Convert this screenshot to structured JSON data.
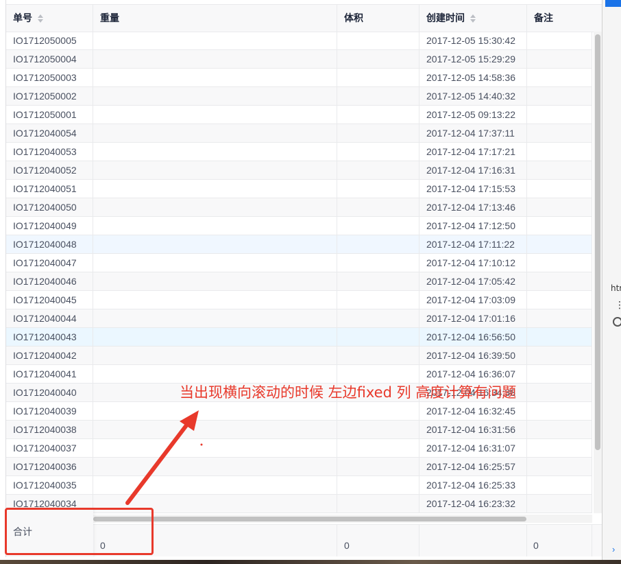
{
  "columns": [
    {
      "label": "单号",
      "sortable": true
    },
    {
      "label": "重量",
      "sortable": false
    },
    {
      "label": "体积",
      "sortable": false
    },
    {
      "label": "创建时间",
      "sortable": true
    },
    {
      "label": "备注",
      "sortable": false
    }
  ],
  "rows": [
    {
      "id": "IO1712050005",
      "time": "2017-12-05 15:30:42"
    },
    {
      "id": "IO1712050004",
      "time": "2017-12-05 15:29:29"
    },
    {
      "id": "IO1712050003",
      "time": "2017-12-05 14:58:36"
    },
    {
      "id": "IO1712050002",
      "time": "2017-12-05 14:40:32"
    },
    {
      "id": "IO1712050001",
      "time": "2017-12-05 09:13:22"
    },
    {
      "id": "IO1712040054",
      "time": "2017-12-04 17:37:11"
    },
    {
      "id": "IO1712040053",
      "time": "2017-12-04 17:17:21"
    },
    {
      "id": "IO1712040052",
      "time": "2017-12-04 17:16:31"
    },
    {
      "id": "IO1712040051",
      "time": "2017-12-04 17:15:53"
    },
    {
      "id": "IO1712040050",
      "time": "2017-12-04 17:13:46"
    },
    {
      "id": "IO1712040049",
      "time": "2017-12-04 17:12:50"
    },
    {
      "id": "IO1712040048",
      "time": "2017-12-04 17:11:22"
    },
    {
      "id": "IO1712040047",
      "time": "2017-12-04 17:10:12"
    },
    {
      "id": "IO1712040046",
      "time": "2017-12-04 17:05:42"
    },
    {
      "id": "IO1712040045",
      "time": "2017-12-04 17:03:09"
    },
    {
      "id": "IO1712040044",
      "time": "2017-12-04 17:01:16"
    },
    {
      "id": "IO1712040043",
      "time": "2017-12-04 16:56:50"
    },
    {
      "id": "IO1712040042",
      "time": "2017-12-04 16:39:50"
    },
    {
      "id": "IO1712040041",
      "time": "2017-12-04 16:36:07"
    },
    {
      "id": "IO1712040040",
      "time": "2017-12-04 16:34:38"
    },
    {
      "id": "IO1712040039",
      "time": "2017-12-04 16:32:45"
    },
    {
      "id": "IO1712040038",
      "time": "2017-12-04 16:31:56"
    },
    {
      "id": "IO1712040037",
      "time": "2017-12-04 16:31:07"
    },
    {
      "id": "IO1712040036",
      "time": "2017-12-04 16:25:57"
    },
    {
      "id": "IO1712040035",
      "time": "2017-12-04 16:25:33"
    },
    {
      "id": "IO1712040034",
      "time": "2017-12-04 16:23:32"
    }
  ],
  "summary": {
    "label": "合计",
    "weight": "0",
    "volume": "0",
    "remark": "0"
  },
  "annotation": "当出现横向滚动的时候 左边fixed 列 高度计算有问题",
  "devtools": {
    "tab_text": "htr"
  },
  "colors": {
    "annotation": "#e8392b",
    "header_bg": "#f8f8f9",
    "hover_row": "#ebf7ff",
    "devtools_blue": "#1a73e8"
  }
}
